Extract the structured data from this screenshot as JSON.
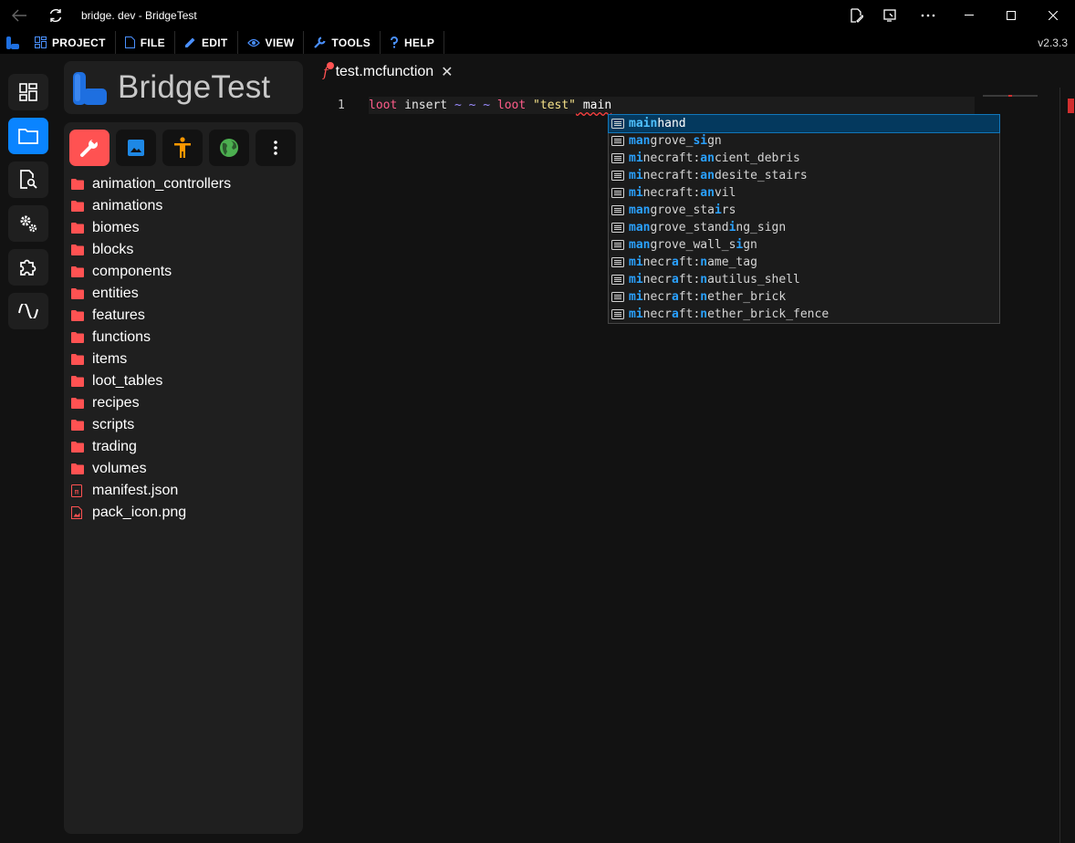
{
  "window": {
    "title": "bridge. dev - BridgeTest",
    "icons": [
      "back-arrow-icon",
      "refresh-icon",
      "edit-note-icon",
      "cast-icon",
      "more-icon",
      "minimize-icon",
      "maximize-icon",
      "close-icon"
    ]
  },
  "menu": {
    "items": [
      {
        "label": "PROJECT",
        "icon": "dashboard-icon"
      },
      {
        "label": "FILE",
        "icon": "file-icon"
      },
      {
        "label": "EDIT",
        "icon": "pencil-icon"
      },
      {
        "label": "VIEW",
        "icon": "eye-icon"
      },
      {
        "label": "TOOLS",
        "icon": "wrench-icon"
      },
      {
        "label": "HELP",
        "icon": "question-icon"
      }
    ],
    "version": "v2.3.3"
  },
  "activity_bar": {
    "items": [
      "dashboard-icon",
      "folder-icon",
      "file-search-icon",
      "settings-gears-icon",
      "extension-icon",
      "wave-icon"
    ],
    "active_index": 1
  },
  "project": {
    "name": "BridgeTest"
  },
  "packs": {
    "items": [
      "behavior-pack-wrench-icon",
      "resource-pack-image-icon",
      "skin-pack-person-icon",
      "world-globe-icon",
      "more-vertical-icon"
    ],
    "active_index": 0,
    "colors": {
      "active": "#ff5252",
      "image": "#1e88e5",
      "person": "#ff9800",
      "globe": "#4caf50"
    }
  },
  "file_tree": {
    "folders": [
      "animation_controllers",
      "animations",
      "biomes",
      "blocks",
      "components",
      "entities",
      "features",
      "functions",
      "items",
      "loot_tables",
      "recipes",
      "scripts",
      "trading",
      "volumes"
    ],
    "files": [
      {
        "name": "manifest.json",
        "icon": "json-file-icon"
      },
      {
        "name": "pack_icon.png",
        "icon": "image-file-icon"
      }
    ],
    "folder_color": "#ff5252"
  },
  "editor": {
    "tab": {
      "label": "test.mcfunction",
      "icon": "function-icon",
      "modified": true
    },
    "line_number": "1",
    "code": {
      "t1": "loot",
      "t2": " insert ",
      "t3": "~ ~ ~",
      "t4": " loot",
      "t5": " \"test\"",
      "t6": " main"
    }
  },
  "suggestions": {
    "selected_index": 0,
    "items": [
      {
        "parts": [
          [
            "main",
            true
          ],
          [
            "hand",
            false
          ]
        ]
      },
      {
        "parts": [
          [
            "man",
            true
          ],
          [
            "grove_",
            false
          ],
          [
            "si",
            true
          ],
          [
            "gn",
            false
          ]
        ]
      },
      {
        "parts": [
          [
            "mi",
            true
          ],
          [
            "necraft:",
            false
          ],
          [
            "an",
            true
          ],
          [
            "cient_debris",
            false
          ]
        ]
      },
      {
        "parts": [
          [
            "mi",
            true
          ],
          [
            "necraft:",
            false
          ],
          [
            "an",
            true
          ],
          [
            "desite_stairs",
            false
          ]
        ]
      },
      {
        "parts": [
          [
            "mi",
            true
          ],
          [
            "necraft:",
            false
          ],
          [
            "an",
            true
          ],
          [
            "vil",
            false
          ]
        ]
      },
      {
        "parts": [
          [
            "man",
            true
          ],
          [
            "grove_sta",
            false
          ],
          [
            "i",
            true
          ],
          [
            "rs",
            false
          ]
        ]
      },
      {
        "parts": [
          [
            "man",
            true
          ],
          [
            "grove_stand",
            false
          ],
          [
            "i",
            true
          ],
          [
            "ng_sign",
            false
          ]
        ]
      },
      {
        "parts": [
          [
            "man",
            true
          ],
          [
            "grove_wall_s",
            false
          ],
          [
            "i",
            true
          ],
          [
            "gn",
            false
          ]
        ]
      },
      {
        "parts": [
          [
            "mi",
            true
          ],
          [
            "necr",
            false
          ],
          [
            "a",
            true
          ],
          [
            "ft:",
            false
          ],
          [
            "n",
            true
          ],
          [
            "ame_tag",
            false
          ]
        ]
      },
      {
        "parts": [
          [
            "mi",
            true
          ],
          [
            "necr",
            false
          ],
          [
            "a",
            true
          ],
          [
            "ft:",
            false
          ],
          [
            "n",
            true
          ],
          [
            "autilus_shell",
            false
          ]
        ]
      },
      {
        "parts": [
          [
            "mi",
            true
          ],
          [
            "necr",
            false
          ],
          [
            "a",
            true
          ],
          [
            "ft:",
            false
          ],
          [
            "n",
            true
          ],
          [
            "ether_brick",
            false
          ]
        ]
      },
      {
        "parts": [
          [
            "mi",
            true
          ],
          [
            "necr",
            false
          ],
          [
            "a",
            true
          ],
          [
            "ft:",
            false
          ],
          [
            "n",
            true
          ],
          [
            "ether_brick_fence",
            false
          ]
        ]
      }
    ]
  }
}
